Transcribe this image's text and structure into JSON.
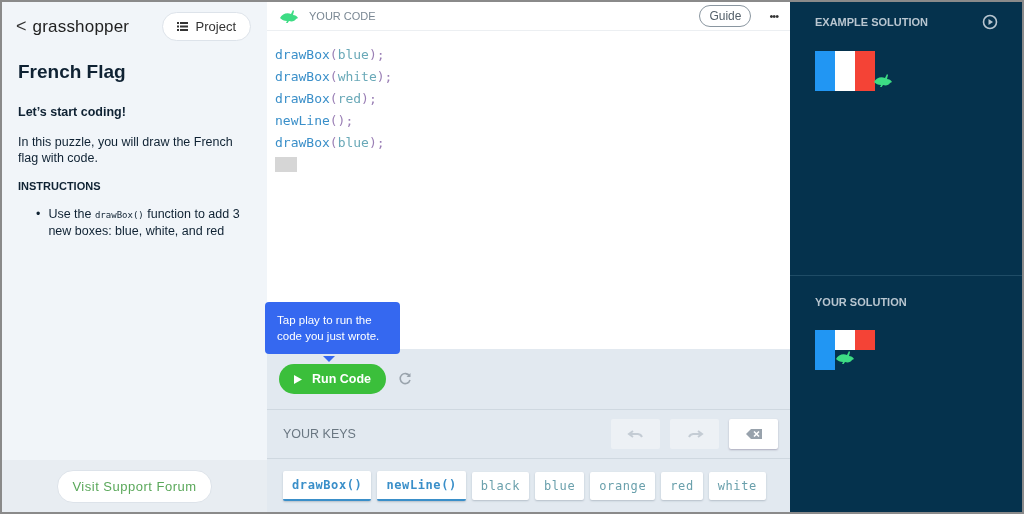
{
  "sidebar": {
    "back": "<",
    "logo": "grasshopper",
    "project_button": "Project",
    "title": "French Flag",
    "subtitle": "Let’s start coding!",
    "intro": "In this puzzle, you will draw the French flag with code.",
    "instructions_heading": "INSTRUCTIONS",
    "instructions": [
      {
        "bullet": "•",
        "before": "Use the ",
        "code": "drawBox()",
        "after": " function to add 3 new boxes: blue, white, and red"
      }
    ],
    "support_button": "Visit Support Forum"
  },
  "editor": {
    "title": "YOUR CODE",
    "guide_button": "Guide",
    "more": "•••",
    "lines": [
      {
        "tokens": [
          {
            "kind": "fn",
            "text": "drawBox"
          },
          {
            "kind": "punc",
            "text": "("
          },
          {
            "kind": "arg",
            "text": "blue"
          },
          {
            "kind": "punc",
            "text": ");"
          }
        ]
      },
      {
        "tokens": [
          {
            "kind": "fn",
            "text": "drawBox"
          },
          {
            "kind": "punc",
            "text": "("
          },
          {
            "kind": "arg",
            "text": "white"
          },
          {
            "kind": "punc",
            "text": ");"
          }
        ]
      },
      {
        "tokens": [
          {
            "kind": "fn",
            "text": "drawBox"
          },
          {
            "kind": "punc",
            "text": "("
          },
          {
            "kind": "arg",
            "text": "red"
          },
          {
            "kind": "punc",
            "text": ");"
          }
        ]
      },
      {
        "tokens": [
          {
            "kind": "fn",
            "text": "newLine"
          },
          {
            "kind": "punc",
            "text": "();"
          }
        ]
      },
      {
        "tokens": [
          {
            "kind": "fn",
            "text": "drawBox"
          },
          {
            "kind": "punc",
            "text": "("
          },
          {
            "kind": "arg",
            "text": "blue"
          },
          {
            "kind": "punc",
            "text": ");"
          }
        ]
      }
    ],
    "tooltip": "Tap play to run the code you just wrote.",
    "run_button": "Run Code"
  },
  "keys": {
    "title": "YOUR KEYS",
    "actions": [
      {
        "kind": "undo",
        "disabled": true
      },
      {
        "kind": "redo",
        "disabled": true
      },
      {
        "kind": "backspace",
        "disabled": false
      }
    ],
    "items": [
      {
        "label": "drawBox()",
        "kind": "function"
      },
      {
        "label": "newLine()",
        "kind": "function"
      },
      {
        "label": "black",
        "kind": "value"
      },
      {
        "label": "blue",
        "kind": "value"
      },
      {
        "label": "orange",
        "kind": "value"
      },
      {
        "label": "red",
        "kind": "value"
      },
      {
        "label": "white",
        "kind": "value"
      }
    ]
  },
  "example_solution": {
    "title": "EXAMPLE SOLUTION"
  },
  "your_solution": {
    "title": "YOUR SOLUTION"
  }
}
